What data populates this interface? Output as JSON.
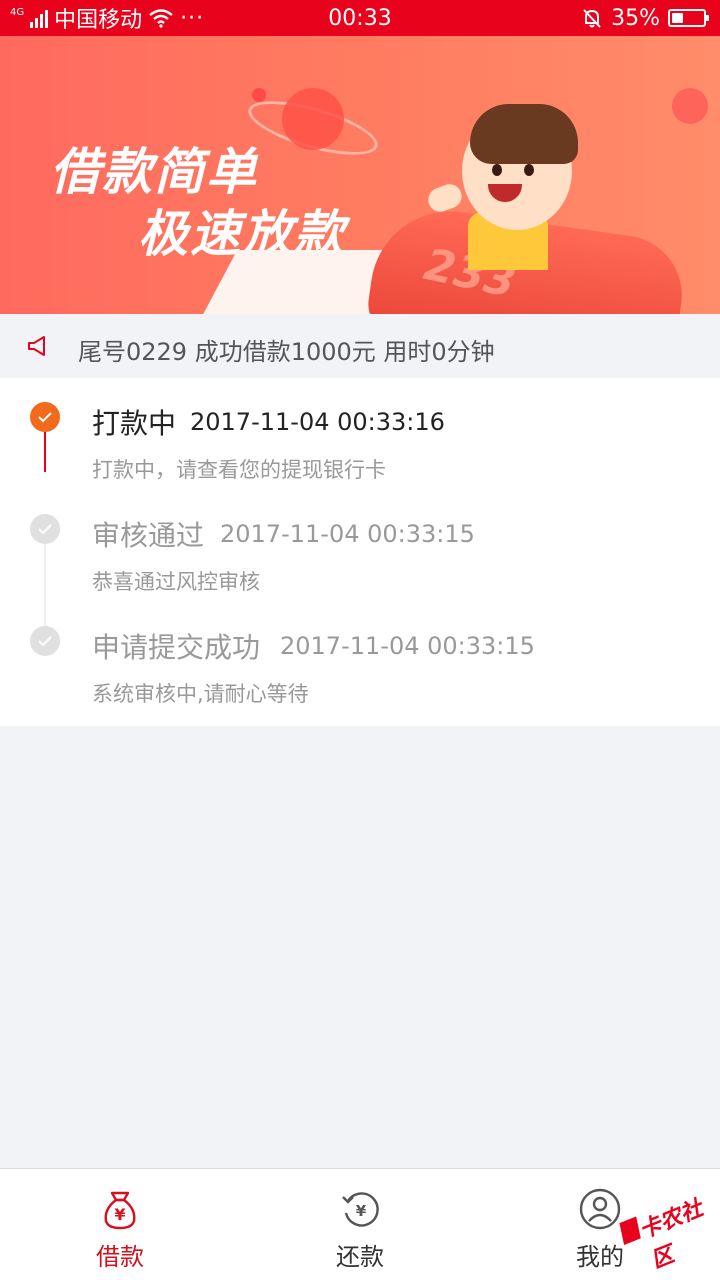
{
  "status_bar": {
    "network_type": "4G",
    "carrier": "中国移动",
    "more": "···",
    "time": "00:33",
    "battery_percent": "35%",
    "battery_level": 0.35
  },
  "banner": {
    "line1": "借款简单",
    "line2": "极速放款",
    "rocket_number": "233"
  },
  "notice": {
    "text": "尾号0229 成功借款1000元 用时0分钟"
  },
  "timeline": [
    {
      "title": "打款中",
      "time": "2017-11-04 00:33:16",
      "desc": "打款中，请查看您的提现银行卡",
      "status": "active"
    },
    {
      "title": "审核通过",
      "time": "2017-11-04 00:33:15",
      "desc": "恭喜通过风控审核",
      "status": "done"
    },
    {
      "title": "申请提交成功",
      "time": "2017-11-04 00:33:15",
      "desc": "系统审核中,请耐心等待",
      "status": "done"
    }
  ],
  "tabs": [
    {
      "label": "借款",
      "icon": "money-bag-icon",
      "active": true
    },
    {
      "label": "还款",
      "icon": "repay-icon",
      "active": false
    },
    {
      "label": "我的",
      "icon": "user-icon",
      "active": false
    }
  ],
  "watermark": "卡农社区",
  "colors": {
    "accent": "#e8021c",
    "step_active": "#f26a1b",
    "step_done": "#e0e0e0"
  }
}
